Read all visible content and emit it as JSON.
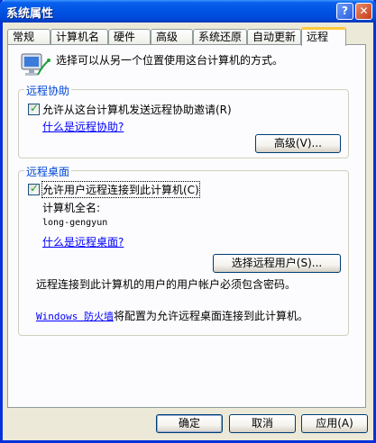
{
  "window": {
    "title": "系统属性",
    "help_label": "?",
    "close_label": "✕"
  },
  "tabs": [
    {
      "label": "常规"
    },
    {
      "label": "计算机名"
    },
    {
      "label": "硬件"
    },
    {
      "label": "高级"
    },
    {
      "label": "系统还原"
    },
    {
      "label": "自动更新"
    },
    {
      "label": "远程",
      "active": true
    }
  ],
  "intro": {
    "text": "选择可以从另一个位置使用这台计算机的方式。",
    "icon": "monitor-network-icon"
  },
  "remote_assistance": {
    "group_label": "远程协助",
    "checkbox_label": "允许从这台计算机发送远程协助邀请(R)",
    "checked": true,
    "help_link": "什么是远程协助?",
    "advanced_button": "高级(V)..."
  },
  "remote_desktop": {
    "group_label": "远程桌面",
    "checkbox_label": "允许用户远程连接到此计算机(C)",
    "checked": true,
    "computer_name_label": "计算机全名:",
    "computer_name_value": "long-gengyun",
    "help_link": "什么是远程桌面?",
    "select_users_button": "选择远程用户(S)...",
    "password_note": "远程连接到此计算机的用户的用户帐户必须包含密码。",
    "firewall_link": "Windows 防火墙",
    "firewall_note": "将配置为允许远程桌面连接到此计算机。"
  },
  "footer": {
    "ok": "确定",
    "cancel": "取消",
    "apply": "应用(A)"
  }
}
